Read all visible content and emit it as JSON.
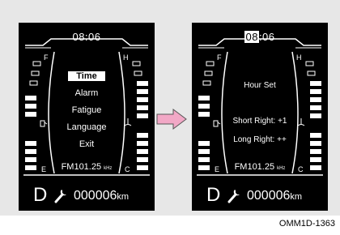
{
  "left_screen": {
    "clock": "08:06",
    "fuel_gauge": {
      "top_label": "F",
      "bottom_label": "E"
    },
    "temp_gauge": {
      "top_label": "H",
      "bottom_label": "C"
    },
    "menu": {
      "items": [
        "Time",
        "Alarm",
        "Fatigue",
        "Language",
        "Exit"
      ],
      "selected": "Time"
    },
    "radio": {
      "frequency": "FM101.25",
      "unit": "kHz"
    },
    "gear": "D",
    "odometer": {
      "value": "000006",
      "unit": "km"
    }
  },
  "right_screen": {
    "clock": {
      "hour": "08",
      "rest": ":06"
    },
    "fuel_gauge": {
      "top_label": "F",
      "bottom_label": "E"
    },
    "temp_gauge": {
      "top_label": "H",
      "bottom_label": "C"
    },
    "hour_set": {
      "title": "Hour Set",
      "short_right": "Short Right: +1",
      "long_right": "Long Right: ++"
    },
    "radio": {
      "frequency": "FM101.25",
      "unit": "kHz"
    },
    "gear": "D",
    "odometer": {
      "value": "000006",
      "unit": "km"
    }
  },
  "caption": "OMM1D-1363",
  "colors": {
    "arrow": "#f2a8c6",
    "screen": "#000000",
    "background": "#e7e7e7"
  }
}
